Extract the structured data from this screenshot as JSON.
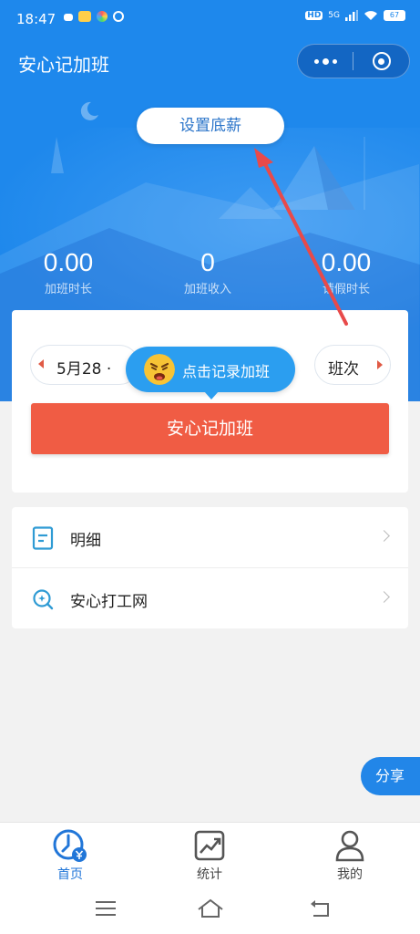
{
  "status_bar": {
    "time": "18:47",
    "network": "5G",
    "battery": "67"
  },
  "header": {
    "app_title": "安心记加班",
    "set_salary_label": "设置底薪"
  },
  "stats": [
    {
      "value": "0.00",
      "label": "加班时长"
    },
    {
      "value": "0",
      "label": "加班收入"
    },
    {
      "value": "0.00",
      "label": "请假时长"
    }
  ],
  "record": {
    "date": "5月28 ·",
    "shift": "班次",
    "tooltip": "点击记录加班",
    "main_button": "安心记加班"
  },
  "menu": [
    {
      "label": "明细",
      "icon": "document-icon"
    },
    {
      "label": "安心打工网",
      "icon": "search-icon"
    }
  ],
  "share_label": "分享",
  "tabs": [
    {
      "label": "首页",
      "icon": "clock-yen-icon",
      "active": true
    },
    {
      "label": "统计",
      "icon": "chart-icon",
      "active": false
    },
    {
      "label": "我的",
      "icon": "user-icon",
      "active": false
    }
  ],
  "colors": {
    "primary": "#1e88ec",
    "accent": "#f05c44",
    "tab_active": "#2176d8"
  }
}
